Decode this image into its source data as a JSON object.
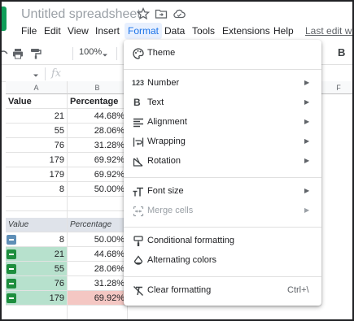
{
  "doc": {
    "title": "Untitled spreadsheet"
  },
  "menubar": {
    "items": [
      "File",
      "Edit",
      "View",
      "Insert",
      "Format",
      "Data",
      "Tools",
      "Extensions",
      "Help"
    ],
    "last_edit": "Last edit was"
  },
  "toolbar": {
    "zoom": "100%",
    "bold_label": "B"
  },
  "formula": {
    "fx": "fx"
  },
  "grid": {
    "columns": [
      "A",
      "B",
      "F"
    ],
    "table1": {
      "headers": [
        "Value",
        "Percentage"
      ],
      "rows": [
        [
          "21",
          "44.68%"
        ],
        [
          "55",
          "28.06%"
        ],
        [
          "76",
          "31.28%"
        ],
        [
          "179",
          "69.92%"
        ],
        [
          "179",
          "69.92%"
        ],
        [
          "8",
          "50.00%"
        ]
      ]
    },
    "table2": {
      "headers": [
        "Value",
        "Percentage"
      ],
      "rows": [
        [
          "8",
          "50.00%"
        ],
        [
          "21",
          "44.68%"
        ],
        [
          "55",
          "28.06%"
        ],
        [
          "76",
          "31.28%"
        ],
        [
          "179",
          "69.92%"
        ]
      ]
    }
  },
  "format_menu": {
    "theme": "Theme",
    "number": "Number",
    "text": "Text",
    "alignment": "Alignment",
    "wrapping": "Wrapping",
    "rotation": "Rotation",
    "font_size": "Font size",
    "merge_cells": "Merge cells",
    "conditional_formatting": "Conditional formatting",
    "alternating_colors": "Alternating colors",
    "clear_formatting": "Clear formatting",
    "clear_formatting_shortcut": "Ctrl+\\",
    "number_icon_text": "123",
    "bold_icon_text": "B"
  },
  "colors": {
    "accent": "#1a73e8",
    "green_fill": "#b7e1cd",
    "pink_fill": "#f4c7c3",
    "table_header": "#dfe3ea"
  }
}
